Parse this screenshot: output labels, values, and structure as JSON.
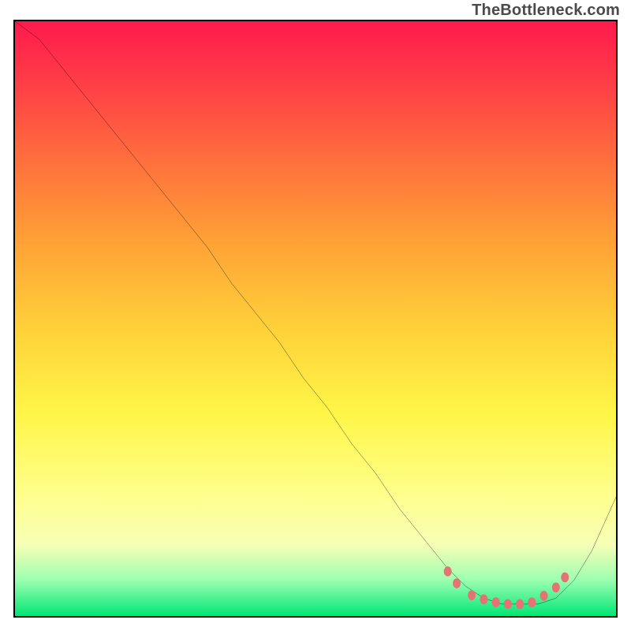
{
  "watermark": "TheBottleneck.com",
  "chart_data": {
    "type": "line",
    "title": "",
    "xlabel": "",
    "ylabel": "",
    "xlim": [
      0,
      100
    ],
    "ylim": [
      0,
      100
    ],
    "grid": false,
    "legend": false,
    "series": [
      {
        "name": "bottleneck-curve",
        "x": [
          0,
          4,
          8,
          12,
          16,
          20,
          24,
          28,
          32,
          36,
          40,
          44,
          48,
          52,
          56,
          60,
          64,
          68,
          72,
          75,
          78,
          81,
          84,
          87,
          90,
          93,
          96,
          100
        ],
        "values": [
          100,
          97,
          92,
          87,
          82,
          77,
          72,
          67,
          62,
          56,
          51,
          46,
          40,
          35,
          29,
          24,
          18,
          13,
          8,
          5,
          3,
          2,
          2,
          2,
          3,
          6,
          11,
          20
        ]
      }
    ],
    "markers": {
      "name": "valley-markers",
      "x": [
        72,
        73.5,
        76,
        78,
        80,
        82,
        84,
        86,
        88,
        90,
        91.5
      ],
      "values": [
        7.5,
        5.5,
        3.5,
        2.8,
        2.3,
        2.0,
        2.0,
        2.3,
        3.4,
        4.8,
        6.5
      ],
      "color": "#e57373",
      "size": 10
    },
    "background_gradient": {
      "stops": [
        {
          "pos": 0.0,
          "color": "#ff1a4d"
        },
        {
          "pos": 0.52,
          "color": "#ffd23a"
        },
        {
          "pos": 0.8,
          "color": "#ffff8e"
        },
        {
          "pos": 1.0,
          "color": "#00e676"
        }
      ]
    }
  }
}
